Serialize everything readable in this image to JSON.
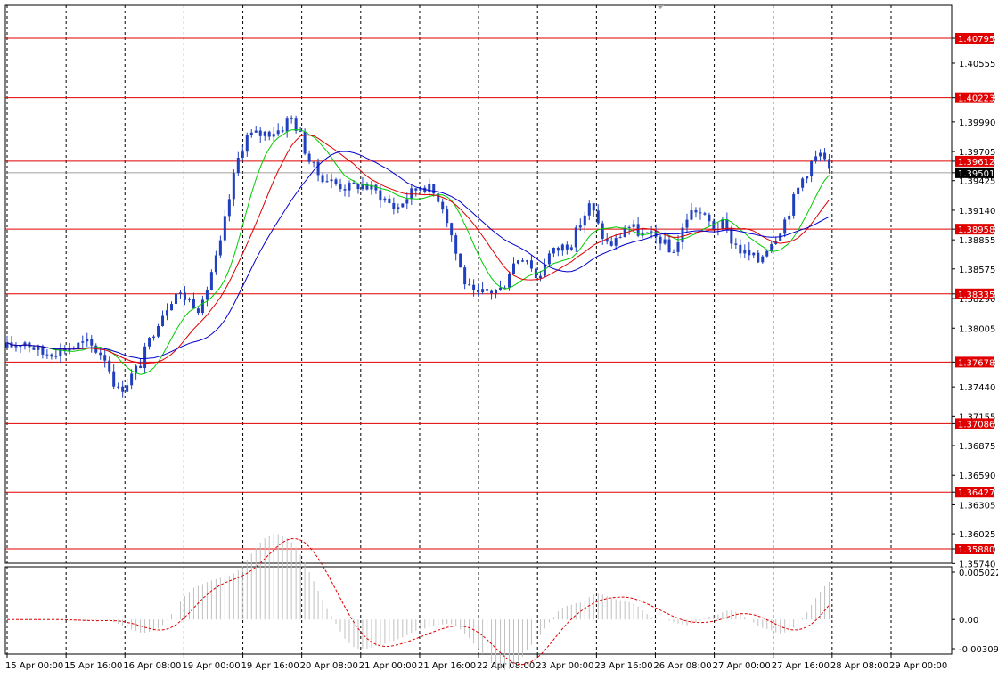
{
  "chart_data": [
    {
      "type": "candlestick",
      "pane": "main",
      "y_min": 1.3574,
      "y_max": 1.40795,
      "x_range": [
        0,
        100
      ],
      "x_tick_labels": [
        {
          "label": "15 Apr 00:00",
          "x": 0
        },
        {
          "label": "15 Apr 16:00",
          "x": 6.67
        },
        {
          "label": "16 Apr 08:00",
          "x": 13.33
        },
        {
          "label": "19 Apr 00:00",
          "x": 20
        },
        {
          "label": "19 Apr 16:00",
          "x": 26.67
        },
        {
          "label": "20 Apr 08:00",
          "x": 33.33
        },
        {
          "label": "21 Apr 00:00",
          "x": 40
        },
        {
          "label": "21 Apr 16:00",
          "x": 46.67
        },
        {
          "label": "22 Apr 08:00",
          "x": 53.33
        },
        {
          "label": "23 Apr 00:00",
          "x": 60
        },
        {
          "label": "23 Apr 16:00",
          "x": 66.67
        },
        {
          "label": "26 Apr 08:00",
          "x": 73.33
        },
        {
          "label": "27 Apr 00:00",
          "x": 80
        },
        {
          "label": "27 Apr 16:00",
          "x": 86.67
        },
        {
          "label": "28 Apr 08:00",
          "x": 93.33
        },
        {
          "label": "29 Apr 00:00",
          "x": 100
        }
      ],
      "y_tick_labels": [
        "1.40795",
        "1.40555",
        "1.40223",
        "1.39990",
        "1.39705",
        "1.39612",
        "1.39501",
        "1.39425",
        "1.39140",
        "1.38958",
        "1.38855",
        "1.38575",
        "1.38335",
        "1.38290",
        "1.38005",
        "1.37678",
        "1.37440",
        "1.37155",
        "1.37086",
        "1.36875",
        "1.36590",
        "1.36427",
        "1.36305",
        "1.36025",
        "1.35880",
        "1.35740"
      ],
      "levels": [
        {
          "label": "1.40795",
          "value": 1.40795
        },
        {
          "label": "1.40223",
          "value": 1.40223
        },
        {
          "label": "1.39612",
          "value": 1.39612
        },
        {
          "label": "1.38958",
          "value": 1.38958
        },
        {
          "label": "1.38335",
          "value": 1.38335
        },
        {
          "label": "1.37678",
          "value": 1.37678
        },
        {
          "label": "1.37086",
          "value": 1.37086
        },
        {
          "label": "1.36427",
          "value": 1.36427
        },
        {
          "label": "1.35880",
          "value": 1.3588
        }
      ],
      "current_price": {
        "label": "1.39501",
        "value": 1.39501
      },
      "anchors_close": [
        [
          0,
          1.3782
        ],
        [
          2,
          1.3788
        ],
        [
          4,
          1.3776
        ],
        [
          6,
          1.378
        ],
        [
          9,
          1.3786
        ],
        [
          11,
          1.3774
        ],
        [
          12.5,
          1.374
        ],
        [
          13.3,
          1.3746
        ],
        [
          15,
          1.3765
        ],
        [
          17,
          1.3807
        ],
        [
          19,
          1.3835
        ],
        [
          21,
          1.3826
        ],
        [
          22,
          1.3818
        ],
        [
          23,
          1.3852
        ],
        [
          24,
          1.3875
        ],
        [
          25,
          1.392
        ],
        [
          26,
          1.396
        ],
        [
          27,
          1.3985
        ],
        [
          29,
          1.3988
        ],
        [
          31,
          1.3992
        ],
        [
          32,
          1.4005
        ],
        [
          33,
          1.399
        ],
        [
          34,
          1.3965
        ],
        [
          35,
          1.395
        ],
        [
          37,
          1.394
        ],
        [
          39,
          1.3935
        ],
        [
          40,
          1.394
        ],
        [
          42,
          1.393
        ],
        [
          44,
          1.3915
        ],
        [
          45,
          1.3925
        ],
        [
          47,
          1.394
        ],
        [
          48,
          1.3932
        ],
        [
          49,
          1.3925
        ],
        [
          50,
          1.39
        ],
        [
          51,
          1.3865
        ],
        [
          52,
          1.384
        ],
        [
          53,
          1.383
        ],
        [
          54,
          1.3835
        ],
        [
          56,
          1.3838
        ],
        [
          57,
          1.386
        ],
        [
          58,
          1.387
        ],
        [
          59,
          1.3868
        ],
        [
          60,
          1.3845
        ],
        [
          61,
          1.387
        ],
        [
          63,
          1.388
        ],
        [
          64,
          1.3885
        ],
        [
          65,
          1.3905
        ],
        [
          66,
          1.392
        ],
        [
          67,
          1.3895
        ],
        [
          68,
          1.388
        ],
        [
          69,
          1.3885
        ],
        [
          70,
          1.39
        ],
        [
          71,
          1.3895
        ],
        [
          72,
          1.389
        ],
        [
          73,
          1.3888
        ],
        [
          74,
          1.3886
        ],
        [
          75,
          1.3872
        ],
        [
          76,
          1.3885
        ],
        [
          77,
          1.391
        ],
        [
          78,
          1.3915
        ],
        [
          79,
          1.3905
        ],
        [
          80,
          1.3898
        ],
        [
          81,
          1.39
        ],
        [
          82,
          1.3885
        ],
        [
          83,
          1.3875
        ],
        [
          84,
          1.387
        ],
        [
          85,
          1.3865
        ],
        [
          86,
          1.388
        ],
        [
          87,
          1.389
        ],
        [
          88,
          1.3905
        ],
        [
          89,
          1.3925
        ],
        [
          90,
          1.3945
        ],
        [
          91,
          1.396
        ],
        [
          92,
          1.3968
        ],
        [
          93,
          1.395
        ]
      ],
      "moving_averages": [
        {
          "color": "#00cc00",
          "period": 5
        },
        {
          "color": "#dd0000",
          "period": 8
        },
        {
          "color": "#0000cc",
          "period": 13
        }
      ]
    },
    {
      "type": "histogram",
      "pane": "oscillator",
      "y_tick_labels": [
        "0.005022",
        "0.00",
        "-0.003096"
      ],
      "y_max": 0.005022,
      "y_min": -0.003096,
      "signal_color": "#dd0000",
      "bar_color": "#c0c0c0"
    }
  ],
  "colors": {
    "grid": "#000000",
    "level_line": "#e00000",
    "label_bg_level": "#e00000",
    "label_text_level": "#ffffff",
    "label_bg_current": "#000000",
    "candle": "#2040c0"
  }
}
